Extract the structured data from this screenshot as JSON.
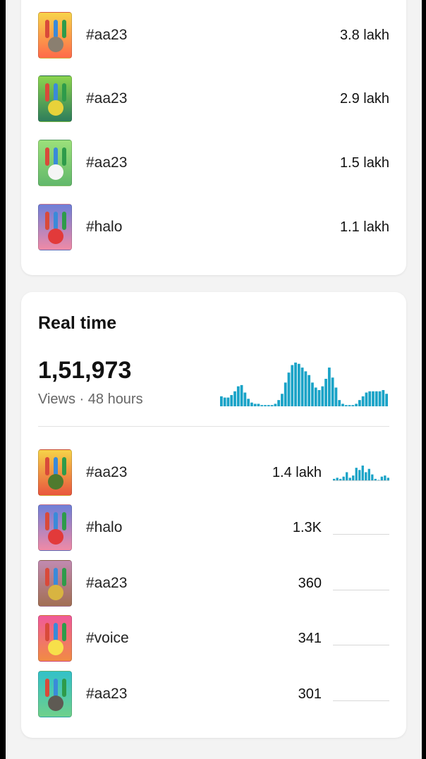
{
  "top_list": [
    {
      "tag": "#aa23",
      "value": "3.8 lakh",
      "thumb": {
        "bg": [
          "#f7d34a",
          "#ff6a4a"
        ],
        "blob": "#8a7f70"
      }
    },
    {
      "tag": "#aa23",
      "value": "2.9 lakh",
      "thumb": {
        "bg": [
          "#8bd44e",
          "#2e7d5b"
        ],
        "blob": "#e8d23a"
      }
    },
    {
      "tag": "#aa23",
      "value": "1.5 lakh",
      "thumb": {
        "bg": [
          "#9be07a",
          "#62b86b"
        ],
        "blob": "#f5f5f5"
      }
    },
    {
      "tag": "#halo",
      "value": "1.1 lakh",
      "thumb": {
        "bg": [
          "#6f7fd8",
          "#f08aa6"
        ],
        "blob": "#e23a3a"
      }
    }
  ],
  "realtime": {
    "title": "Real time",
    "views": "1,51,973",
    "subtitle": "Views · 48 hours",
    "accent": "#1aa3c7",
    "bars": [
      8,
      7,
      7,
      9,
      12,
      16,
      17,
      11,
      6,
      3,
      2,
      2,
      1,
      1,
      1,
      1,
      2,
      5,
      10,
      19,
      27,
      33,
      35,
      34,
      31,
      28,
      25,
      19,
      15,
      13,
      16,
      22,
      31,
      23,
      15,
      5,
      2,
      1,
      1,
      1,
      2,
      5,
      8,
      11,
      12,
      12,
      12,
      12,
      13,
      10
    ]
  },
  "realtime_list": [
    {
      "tag": "#aa23",
      "value": "1.4 lakh",
      "trend": "spark",
      "thumb": {
        "bg": [
          "#f6d248",
          "#e9563e"
        ],
        "blob": "#4f7a2e"
      }
    },
    {
      "tag": "#halo",
      "value": "1.3K",
      "trend": "flat",
      "thumb": {
        "bg": [
          "#6f7fd8",
          "#f08aa6"
        ],
        "blob": "#e23a3a"
      }
    },
    {
      "tag": "#aa23",
      "value": "360",
      "trend": "flat",
      "thumb": {
        "bg": [
          "#c18ab0",
          "#a26f54"
        ],
        "blob": "#d8b441"
      }
    },
    {
      "tag": "#voice",
      "value": "341",
      "trend": "flat",
      "thumb": {
        "bg": [
          "#f05a9a",
          "#f18b43"
        ],
        "blob": "#f7e04a"
      }
    },
    {
      "tag": "#aa23",
      "value": "301",
      "trend": "flat",
      "thumb": {
        "bg": [
          "#33c1c8",
          "#6ed08b"
        ],
        "blob": "#5e5a53"
      }
    }
  ],
  "row1_spark": [
    2,
    3,
    2,
    4,
    8,
    3,
    5,
    12,
    10,
    14,
    8,
    11,
    6,
    2,
    1,
    4,
    5,
    3
  ]
}
